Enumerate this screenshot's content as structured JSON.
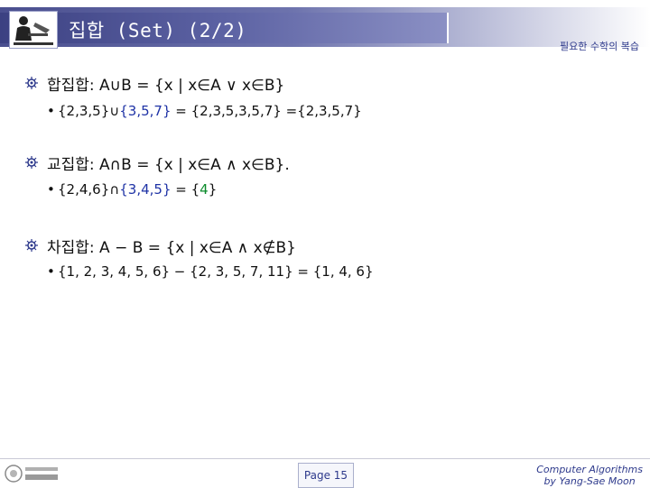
{
  "header": {
    "title": "집합 (Set) (2/2)",
    "section_tag": "필요한 수학의 복습"
  },
  "items": [
    {
      "text": "합집합: A∪B = {x | x∈A ∨ x∈B}",
      "example": [
        "{2,3,5}",
        "∪",
        "{3,5,7}",
        " = {2,3,5,3,5,7} ={2,3,5,7}"
      ]
    },
    {
      "text": "교집합: A∩B = {x | x∈A ∧ x∈B}.",
      "example": [
        "{2,4,6}",
        "∩",
        "{3,4,5}",
        " = {",
        "4",
        "}"
      ]
    },
    {
      "text": "차집합: A − B = {x | x∈A ∧ x∉B}",
      "example": [
        "{1, 2, 3, 4, 5, 6} − {2, 3, 5, 7, 11} = {1, 4, 6}"
      ]
    }
  ],
  "sub_bullet_glyph": "•",
  "footer": {
    "page_label": "Page 15",
    "credit_line1": "Computer Algorithms",
    "credit_line2": "by Yang-Sae Moon"
  },
  "colors": {
    "accent": "#2e3a8c",
    "highlight_blue": "#1f33a6",
    "highlight_green": "#0a8a2a"
  }
}
